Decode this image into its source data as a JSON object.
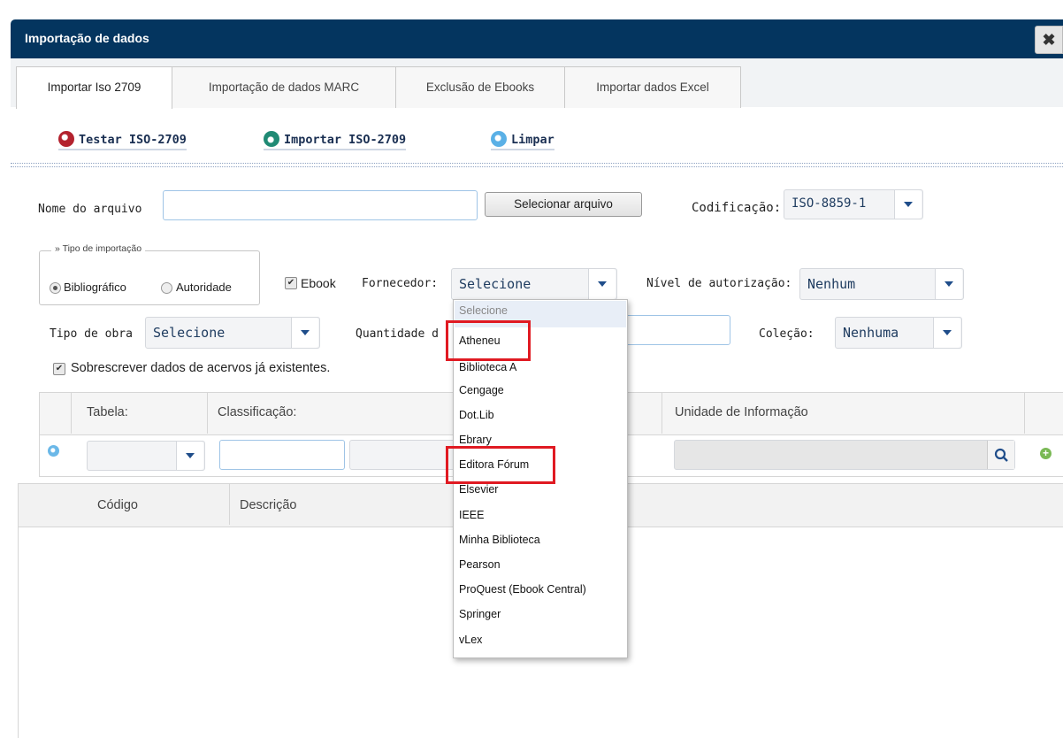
{
  "window": {
    "title": "Importação de dados",
    "close_symbol": "✖"
  },
  "tabs": [
    {
      "label": "Importar Iso 2709",
      "active": true
    },
    {
      "label": "Importação de dados MARC",
      "active": false
    },
    {
      "label": "Exclusão de Ebooks",
      "active": false
    },
    {
      "label": "Importar dados Excel",
      "active": false
    }
  ],
  "toolbar": {
    "test_label": "Testar ISO-2709",
    "import_label": "Importar ISO-2709",
    "clear_label": "Limpar"
  },
  "file": {
    "name_label": "Nome do arquivo",
    "name_value": "",
    "select_button": "Selecionar arquivo",
    "encoding_label": "Codificação:",
    "encoding_value": "ISO-8859-1"
  },
  "import_type": {
    "legend": "» Tipo de importação",
    "options": [
      {
        "label": "Bibliográfico",
        "selected": true
      },
      {
        "label": "Autoridade",
        "selected": false
      }
    ]
  },
  "ebook": {
    "label": "Ebook",
    "checked": true
  },
  "provider": {
    "label": "Fornecedor:",
    "value": "Selecione",
    "options": [
      "Selecione",
      "Atheneu",
      "Biblioteca A",
      "Cengage",
      "Dot.Lib",
      "Ebrary",
      "Editora Fórum",
      "Elsevier",
      "IEEE",
      "Minha Biblioteca",
      "Pearson",
      "ProQuest (Ebook Central)",
      "Springer",
      "vLex"
    ],
    "highlighted": [
      "Atheneu",
      "Editora Fórum"
    ]
  },
  "authorization": {
    "label": "Nível de autorização:",
    "value": "Nenhum"
  },
  "work_type": {
    "label": "Tipo de obra",
    "value": "Selecione"
  },
  "quantity": {
    "label": "Quantidade d",
    "value": ""
  },
  "collection": {
    "label": "Coleção:",
    "value": "Nenhuma"
  },
  "overwrite": {
    "label": "Sobrescrever dados de acervos já existentes.",
    "checked": true
  },
  "grid": {
    "col_tabela": "Tabela:",
    "col_classificacao": "Classificação:",
    "col_unidade": "Unidade de Informação"
  },
  "list": {
    "col_codigo": "Código",
    "col_descricao": "Descrição"
  },
  "colors": {
    "title_bar": "#04355f",
    "highlight": "#e01a22",
    "link": "#1a2f52"
  }
}
